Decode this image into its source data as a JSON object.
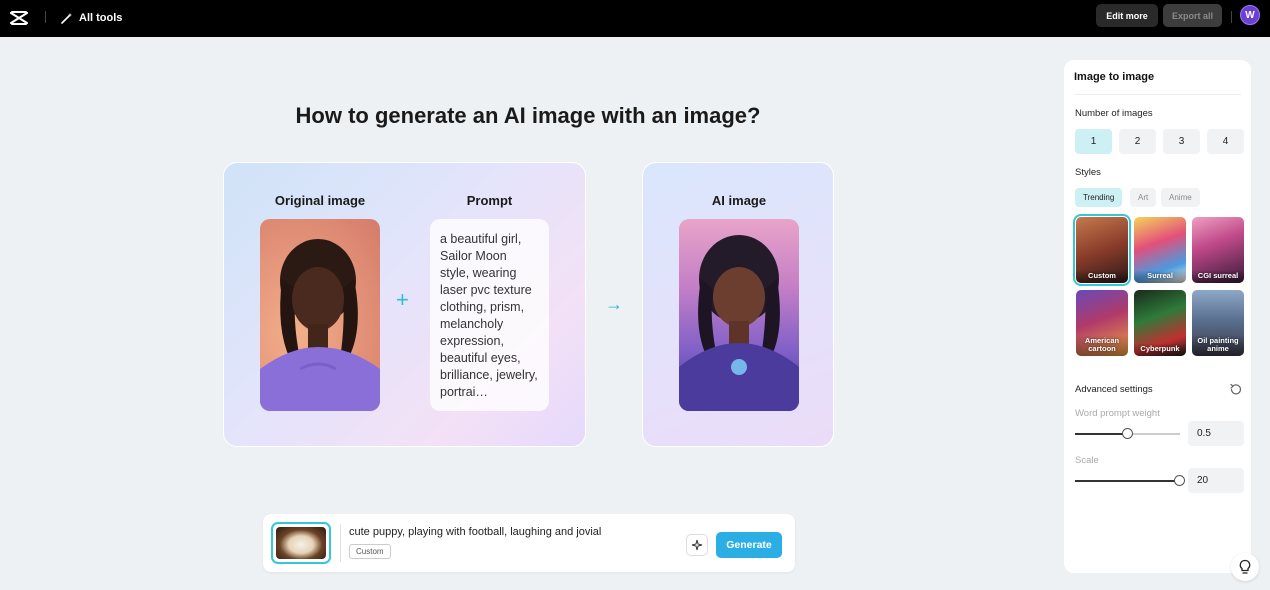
{
  "topbar": {
    "all_tools_label": "All tools",
    "edit_more_label": "Edit more",
    "export_all_label": "Export all",
    "avatar_initial": "W"
  },
  "main": {
    "heading": "How to generate an AI image with an image?",
    "original_title": "Original image",
    "prompt_title": "Prompt",
    "prompt_text": "a beautiful girl, Sailor Moon style, wearing laser pvc texture clothing, prism, melancholy expression, beautiful eyes, brilliance, jewelry, portrai…",
    "ai_title": "AI image"
  },
  "prompt_bar": {
    "text": "cute puppy, playing with football, laughing and jovial",
    "style_tag": "Custom",
    "generate_label": "Generate"
  },
  "panel": {
    "title": "Image to image",
    "number_label": "Number of images",
    "numbers": [
      "1",
      "2",
      "3",
      "4"
    ],
    "selected_number": "1",
    "styles_label": "Styles",
    "style_tabs": [
      "Trending",
      "Art",
      "Anime"
    ],
    "styles": [
      {
        "name": "Custom"
      },
      {
        "name": "Surreal"
      },
      {
        "name": "CGI surreal"
      },
      {
        "name": "American cartoon"
      },
      {
        "name": "Cyberpunk"
      },
      {
        "name": "Oil painting anime"
      }
    ],
    "advanced_label": "Advanced settings",
    "word_weight_label": "Word prompt weight",
    "word_weight_value": "0.5",
    "scale_label": "Scale",
    "scale_value": "20"
  },
  "colors": {
    "accent": "#2aaee3",
    "accent_light": "#cdf0f5",
    "topbar": "#000000"
  }
}
